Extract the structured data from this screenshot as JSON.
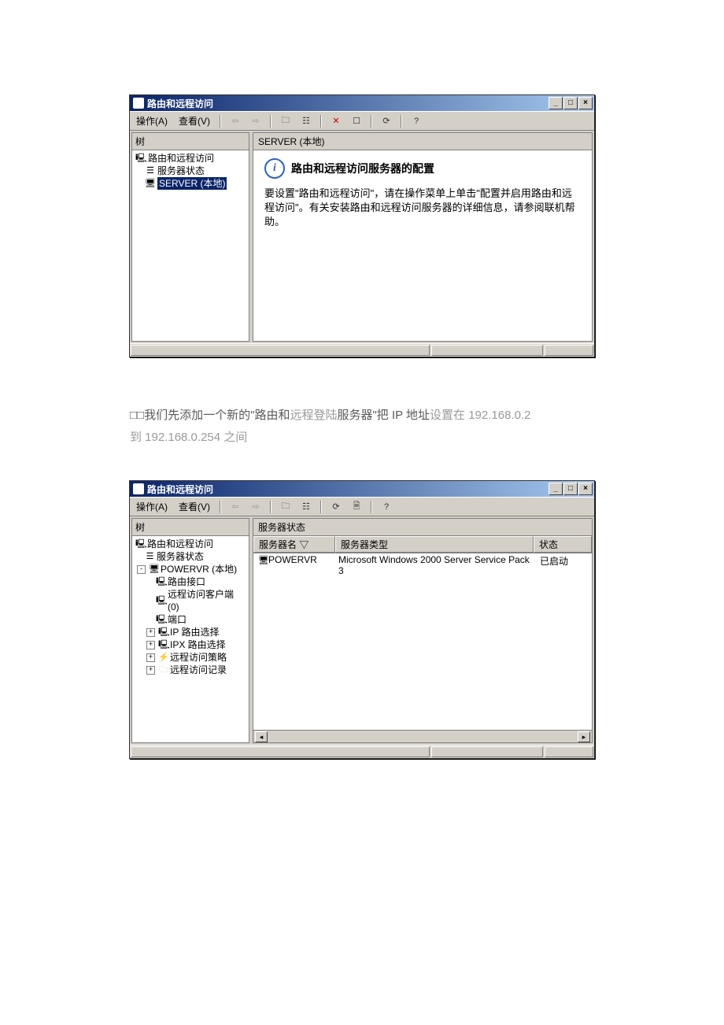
{
  "win1": {
    "title": "路由和远程访问",
    "menu": {
      "action": "操作(A)",
      "view": "查看(V)"
    },
    "tree_label": "树",
    "tree": {
      "root": "路由和远程访问",
      "status": "服务器状态",
      "server": "SERVER (本地)"
    },
    "content_header": "SERVER (本地)",
    "info_title": "路由和远程访问服务器的配置",
    "info_text": "要设置\"路由和远程访问\"，请在操作菜单上单击\"配置并启用路由和远程访问\"。有关安装路由和远程访问服务器的详细信息，请参阅联机帮助。"
  },
  "para": {
    "line1a": "□□我们先添加一个新的\"路由和",
    "line1b": "远程登陆",
    "line1c": "服务器\"把 IP 地址",
    "line1d": "设置在 192.168.0.2",
    "line2": "到 192.168.0.254 之间"
  },
  "win2": {
    "title": "路由和远程访问",
    "menu": {
      "action": "操作(A)",
      "view": "查看(V)"
    },
    "tree_label": "树",
    "content_header": "服务器状态",
    "tree": {
      "root": "路由和远程访问",
      "status": "服务器状态",
      "server": "POWERVR (本地)",
      "items": {
        "a": "路由接口",
        "b": "远程访问客户端 (0)",
        "c": "端口",
        "d": "IP 路由选择",
        "e": "IPX 路由选择",
        "f": "远程访问策略",
        "g": "远程访问记录"
      }
    },
    "cols": {
      "name": "服务器名",
      "type": "服务器类型",
      "status": "状态"
    },
    "row": {
      "name": "POWERVR",
      "type": "Microsoft Windows 2000 Server Service Pack 3",
      "status": "已启动"
    }
  }
}
